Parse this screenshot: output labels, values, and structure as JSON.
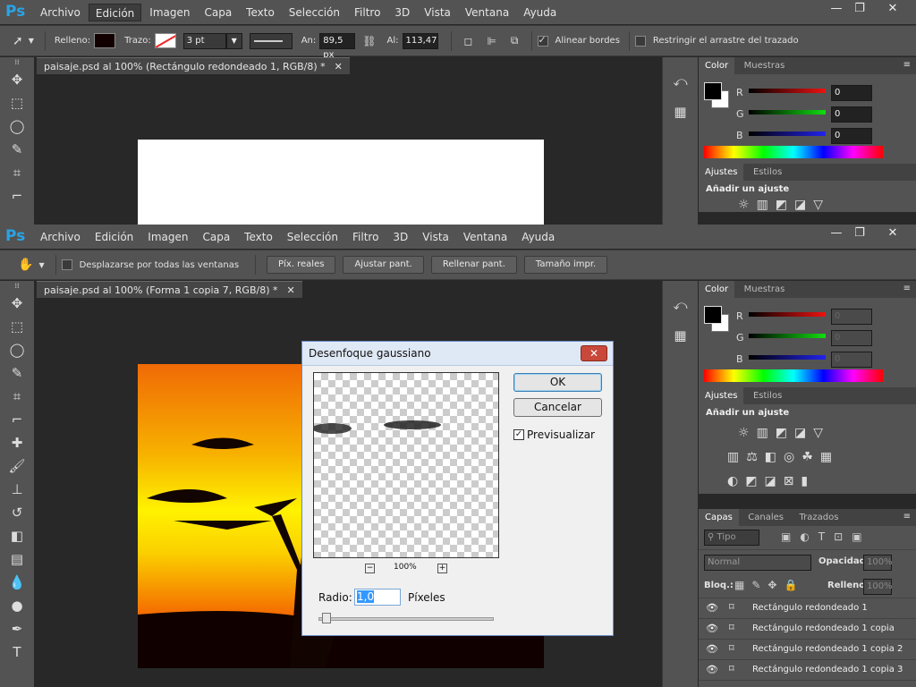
{
  "app_logo": "Ps",
  "menu": [
    "Archivo",
    "Edición",
    "Imagen",
    "Capa",
    "Texto",
    "Selección",
    "Filtro",
    "3D",
    "Vista",
    "Ventana",
    "Ayuda"
  ],
  "window_controls": [
    "—",
    "❐",
    "✕"
  ],
  "top": {
    "options": {
      "fill_label": "Relleno:",
      "stroke_label": "Trazo:",
      "stroke_size": "3 pt",
      "width_label": "An:",
      "width_value": "89,5 px",
      "height_label": "Al:",
      "height_value": "113,47 p",
      "align_edges": "Alinear bordes",
      "constrain": "Restringir el arrastre del trazado"
    },
    "doc_tab": "paisaje.psd al 100% (Rectángulo redondeado 1, RGB/8) *"
  },
  "bottom": {
    "options": {
      "scroll_all": "Desplazarse por todas las ventanas",
      "buttons": [
        "Píx. reales",
        "Ajustar pant.",
        "Rellenar pant.",
        "Tamaño impr."
      ]
    },
    "doc_tab": "paisaje.psd al 100% (Forma 1 copia 7, RGB/8) *"
  },
  "color_panel": {
    "tabs": [
      "Color",
      "Muestras"
    ],
    "channels": [
      {
        "label": "R",
        "value": "0"
      },
      {
        "label": "G",
        "value": "0"
      },
      {
        "label": "B",
        "value": "0"
      }
    ]
  },
  "adjust_panel": {
    "tabs": [
      "Ajustes",
      "Estilos"
    ],
    "title": "Añadir un ajuste"
  },
  "layers_panel": {
    "tabs": [
      "Capas",
      "Canales",
      "Trazados"
    ],
    "kind_label": "Tipo",
    "blend_mode": "Normal",
    "opacity_label": "Opacidad:",
    "opacity_value": "100%",
    "lock_label": "Bloq.:",
    "fill_label": "Relleno:",
    "fill_value": "100%",
    "layers": [
      "Rectángulo redondeado 1",
      "Rectángulo redondeado 1 copia",
      "Rectángulo redondeado 1 copia 2",
      "Rectángulo redondeado 1 copia 3"
    ]
  },
  "dialog": {
    "title": "Desenfoque gaussiano",
    "ok": "OK",
    "cancel": "Cancelar",
    "preview": "Previsualizar",
    "zoom": "100%",
    "radius_label": "Radio:",
    "radius_value": "1,0",
    "units": "Píxeles"
  },
  "colors": {
    "panel": "#535353",
    "canvas_bg": "#282828",
    "accent": "#28a3e6"
  }
}
